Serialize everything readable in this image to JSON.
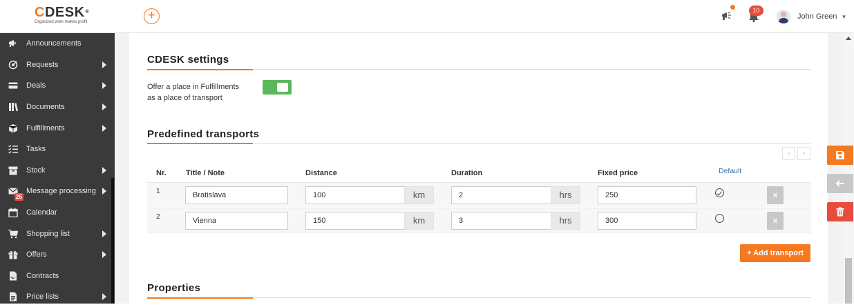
{
  "app": {
    "logo_text": "CDESK",
    "logo_tagline": "Organized work makes profit",
    "notifications_count": "10",
    "user_name": "John Green"
  },
  "sidebar": {
    "items": [
      {
        "label": "Announcements",
        "icon": "megaphone-icon",
        "submenu": false
      },
      {
        "label": "Requests",
        "icon": "requests-icon",
        "submenu": true
      },
      {
        "label": "Deals",
        "icon": "card-icon",
        "submenu": true
      },
      {
        "label": "Documents",
        "icon": "books-icon",
        "submenu": true
      },
      {
        "label": "Fulfillments",
        "icon": "box-icon",
        "submenu": true
      },
      {
        "label": "Tasks",
        "icon": "checklist-icon",
        "submenu": false
      },
      {
        "label": "Stock",
        "icon": "archive-icon",
        "submenu": true
      },
      {
        "label": "Message processing",
        "icon": "envelope-icon",
        "submenu": true,
        "badge": "25"
      },
      {
        "label": "Calendar",
        "icon": "calendar-icon",
        "submenu": false
      },
      {
        "label": "Shopping list",
        "icon": "cart-icon",
        "submenu": true
      },
      {
        "label": "Offers",
        "icon": "gift-icon",
        "submenu": true
      },
      {
        "label": "Contracts",
        "icon": "contract-icon",
        "submenu": false
      },
      {
        "label": "Price lists",
        "icon": "pricelist-icon",
        "submenu": true
      }
    ]
  },
  "settings": {
    "title": "CDESK settings",
    "offer_label": "Offer a place in Fulfillments as a place of transport",
    "offer_enabled": true
  },
  "transports": {
    "title": "Predefined transports",
    "columns": {
      "nr": "Nr.",
      "title": "Title / Note",
      "distance": "Distance",
      "duration": "Duration",
      "price": "Fixed price",
      "default": "Default"
    },
    "distance_unit": "km",
    "duration_unit": "hrs",
    "rows": [
      {
        "nr": "1",
        "title": "Bratislava",
        "distance": "100",
        "duration": "2",
        "price": "250",
        "default": true
      },
      {
        "nr": "2",
        "title": "Vienna",
        "distance": "150",
        "duration": "3",
        "price": "300",
        "default": false
      }
    ],
    "add_label": "+ Add transport",
    "delete_label": "×",
    "pager_prev": "‹",
    "pager_next": "›"
  },
  "properties": {
    "title": "Properties"
  },
  "colors": {
    "accent": "#f47920",
    "toggle_on": "#5cb85c",
    "danger": "#e74c3c",
    "sidebar_bg": "#3a3a3a"
  }
}
